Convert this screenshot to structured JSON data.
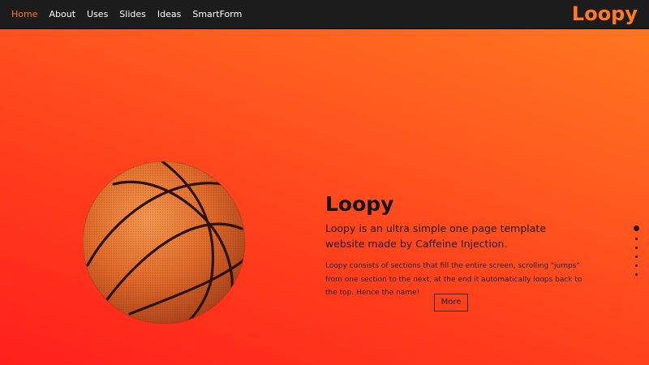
{
  "nav": {
    "items": [
      {
        "label": "Home",
        "active": true
      },
      {
        "label": "About",
        "active": false
      },
      {
        "label": "Uses",
        "active": false
      },
      {
        "label": "Slides",
        "active": false
      },
      {
        "label": "Ideas",
        "active": false
      },
      {
        "label": "SmartForm",
        "active": false
      }
    ],
    "brand": "Loopy"
  },
  "hero": {
    "image": "basketball",
    "title": "Loopy",
    "subtitle": "Loopy is an ultra simple one page template website made by Caffeine Injection.",
    "body": "Loopy consists of sections that fill the entire screen, scrolling \"jumps\" from one section to the next, at the end it automatically loops back to the top. Hence the name!",
    "more_label": "More"
  },
  "pager": {
    "count": 6,
    "active_index": 0
  },
  "colors": {
    "accent": "#ff7a22",
    "topbar": "#1c1c1c",
    "gradient_start": "#ff1f1c",
    "gradient_end": "#ff7a1f"
  }
}
